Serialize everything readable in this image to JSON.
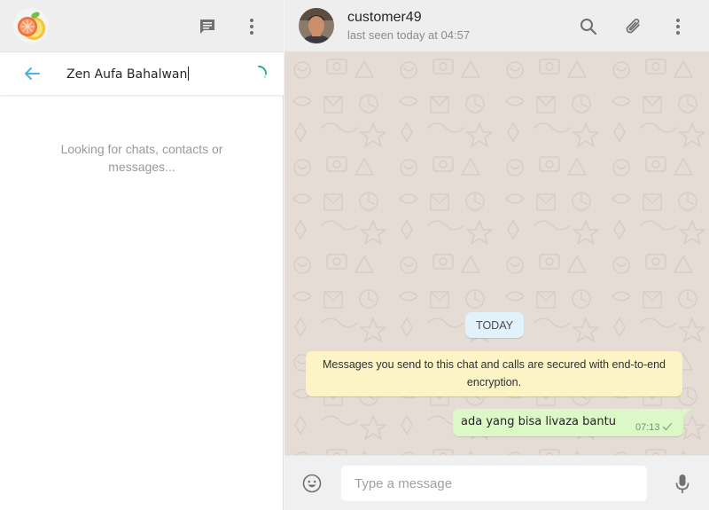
{
  "left_panel": {
    "search": {
      "value": "Zen Aufa Bahalwan"
    },
    "status_message": "Looking for chats, contacts or messages..."
  },
  "chat": {
    "contact": {
      "name": "customer49",
      "status": "last seen today at 04:57"
    },
    "date_divider": "TODAY",
    "encryption_notice": "Messages you send to this chat and calls are secured with end-to-end encryption.",
    "messages": [
      {
        "direction": "outgoing",
        "text": "ada yang bisa livaza bantu",
        "time": "07:13",
        "status": "sent"
      }
    ],
    "composer": {
      "placeholder": "Type a message"
    }
  },
  "colors": {
    "header_bg": "#eeeeee",
    "chat_bg": "#e5ddd5",
    "outgoing_bubble": "#dcf8c6",
    "notice_bubble": "#fcf4c4",
    "date_chip": "#e1f2fb",
    "accent": "#4fb3d9",
    "icon_gray": "#707070",
    "spinner": "#28b07e"
  },
  "icons": [
    "fruit-avatar",
    "new-chat-icon",
    "menu-dots-icon",
    "back-arrow-icon",
    "spinner-icon",
    "search-icon",
    "paperclip-icon",
    "emoji-icon",
    "microphone-icon",
    "single-check-icon"
  ]
}
